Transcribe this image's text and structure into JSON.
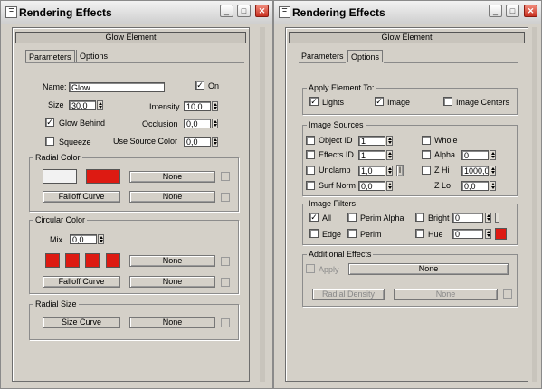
{
  "left": {
    "title": "Rendering Effects",
    "rollout": "Glow Element",
    "tabs": [
      "Parameters",
      "Options"
    ],
    "name_label": "Name:",
    "name_value": "Glow",
    "on_label": "On",
    "size_label": "Size",
    "size_value": "30,0",
    "intensity_label": "Intensity",
    "intensity_value": "10,0",
    "glow_behind_label": "Glow Behind",
    "occlusion_label": "Occlusion",
    "occlusion_value": "0,0",
    "squeeze_label": "Squeeze",
    "use_source_color_label": "Use Source Color",
    "use_source_color_value": "0,0",
    "radial_color": {
      "title": "Radial Color",
      "map_none": "None",
      "falloff_label": "Falloff Curve",
      "falloff_none": "None",
      "colors": [
        "#f2f2f2",
        "#dd1a12"
      ]
    },
    "circular_color": {
      "title": "Circular Color",
      "mix_label": "Mix",
      "mix_value": "0,0",
      "map_none": "None",
      "falloff_label": "Falloff Curve",
      "falloff_none": "None",
      "colors": [
        "#dd1a12",
        "#dd1a12",
        "#dd1a12",
        "#dd1a12"
      ]
    },
    "radial_size": {
      "title": "Radial Size",
      "size_curve_label": "Size Curve",
      "none": "None"
    }
  },
  "right": {
    "title": "Rendering Effects",
    "rollout": "Glow Element",
    "tabs": [
      "Parameters",
      "Options"
    ],
    "apply_title": "Apply Element To:",
    "apply_lights": "Lights",
    "apply_image": "Image",
    "apply_image_centers": "Image Centers",
    "image_sources_title": "Image Sources",
    "object_id_label": "Object ID",
    "object_id_value": "1",
    "whole_label": "Whole",
    "effects_id_label": "Effects ID",
    "effects_id_value": "1",
    "alpha_label": "Alpha",
    "alpha_value": "0",
    "unclamp_label": "Unclamp",
    "unclamp_value": "1,0",
    "i_label": "I",
    "z_hi_label": "Z Hi",
    "z_hi_value": "1000,0",
    "surf_norm_label": "Surf Norm",
    "surf_norm_value": "0,0",
    "z_lo_label": "Z Lo",
    "z_lo_value": "0,0",
    "image_filters_title": "Image Filters",
    "filter_all": "All",
    "filter_perim_alpha": "Perim Alpha",
    "filter_bright": "Bright",
    "filter_bright_value": "0",
    "filter_edge": "Edge",
    "filter_perim": "Perim",
    "filter_hue": "Hue",
    "filter_hue_value": "0",
    "hue_color": "#dd1a12",
    "additional_title": "Additional Effects",
    "apply_label": "Apply",
    "apply_none": "None",
    "radial_density_label": "Radial Density",
    "radial_density_none": "None"
  },
  "window_buttons": {
    "minimize": "_",
    "maximize": "□",
    "close": "✕"
  }
}
